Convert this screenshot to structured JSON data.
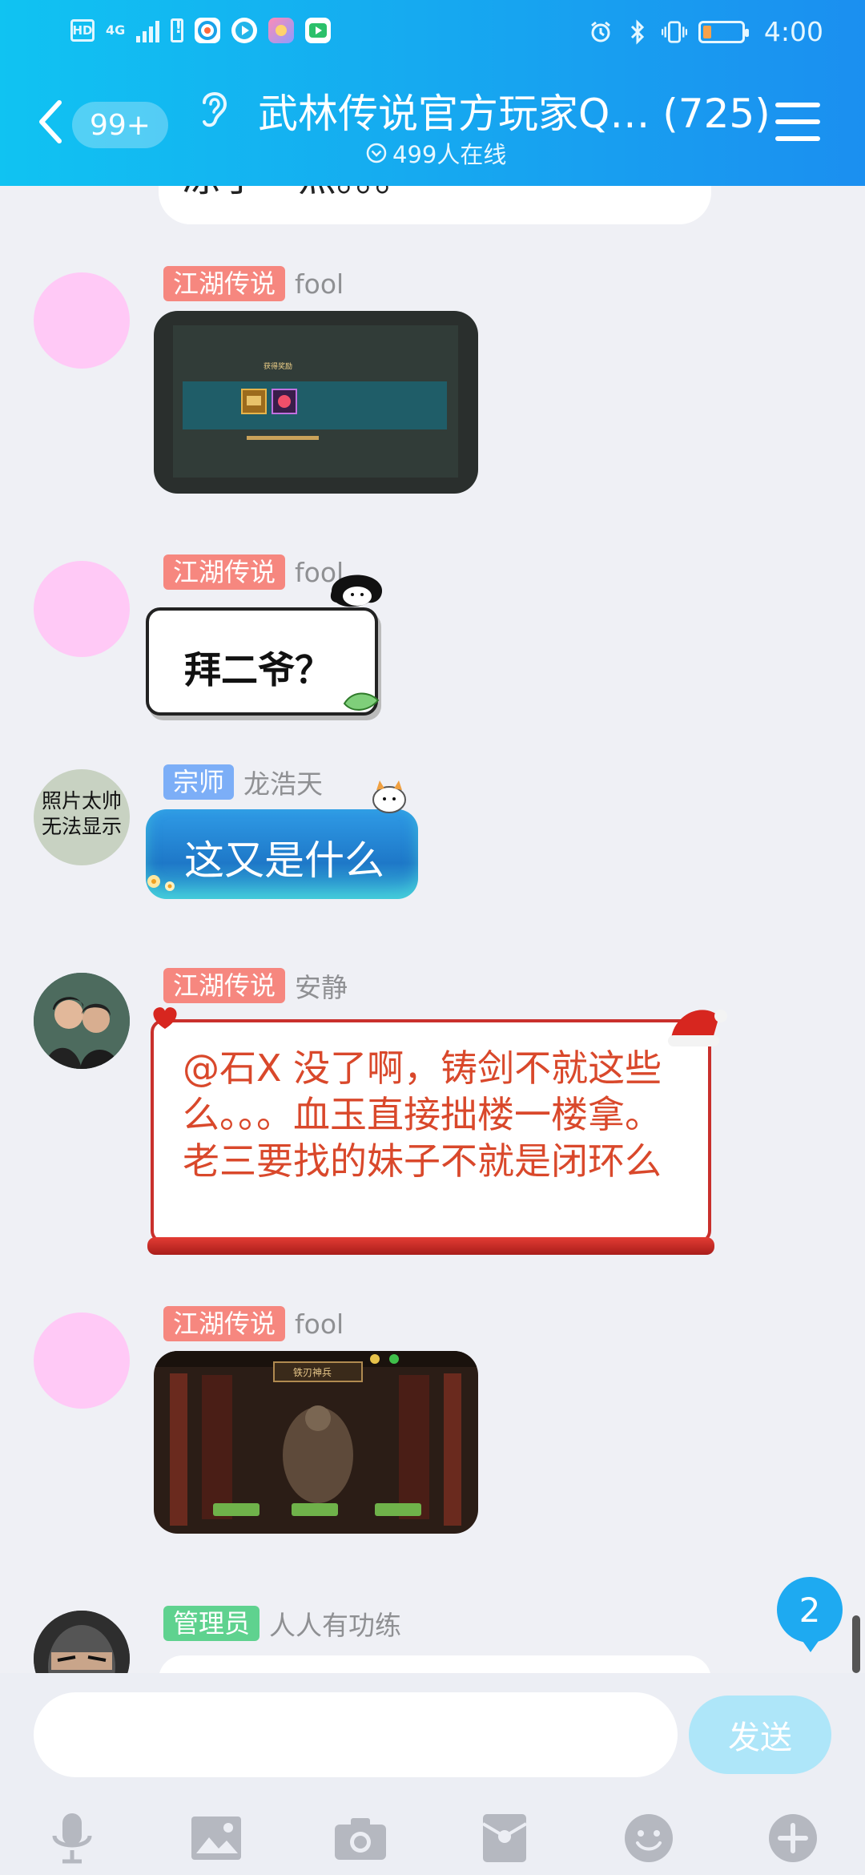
{
  "status_bar": {
    "hd": "HD",
    "network": "4G",
    "time": "4:00"
  },
  "header": {
    "unread_count": "99+",
    "title": "武林传说官方玩家Q… (725)",
    "online": "499人在线"
  },
  "messages": [
    {
      "preview_text": "凉了一点。。。"
    },
    {
      "badge": "江湖传说",
      "name": "fool",
      "type": "image",
      "image_caption": "获得奖励"
    },
    {
      "badge": "江湖传说",
      "name": "fool",
      "type": "sticker",
      "text": "拜二爷？"
    },
    {
      "badge": "宗师",
      "name": "龙浩天",
      "avatar_text": "照片太帅\n无法显示",
      "text": "这又是什么"
    },
    {
      "badge": "江湖传说",
      "name": "安静",
      "text": "@石X 没了啊，铸剑不就这些么。。。血玉直接拙楼一楼拿。老三要找的妹子不就是闭环么"
    },
    {
      "badge": "江湖传说",
      "name": "fool",
      "type": "image",
      "image_caption": "铁刃神兵"
    },
    {
      "badge": "管理员",
      "name": "人人有功练"
    }
  ],
  "new_message_count": "2",
  "composer": {
    "placeholder": "",
    "send_label": "发送"
  },
  "colors": {
    "header_start": "#10c3f2",
    "header_end": "#1b8ff0",
    "badge_jianghu": "#f6877f",
    "badge_zongshi": "#7caef7",
    "badge_admin": "#5fd28f",
    "send_button": "#aee6f9"
  },
  "toolbar_icons": [
    "microphone-icon",
    "image-icon",
    "camera-icon",
    "red-packet-icon",
    "emoji-icon",
    "plus-icon"
  ]
}
